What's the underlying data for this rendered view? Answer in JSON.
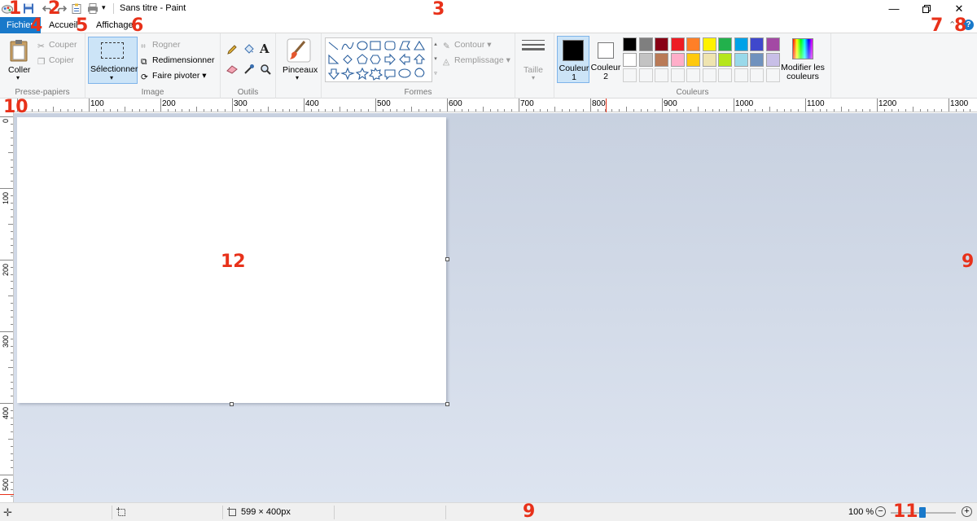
{
  "window": {
    "title": "Sans titre - Paint",
    "controls": [
      "minimize",
      "restore",
      "close"
    ]
  },
  "quick_access": {
    "items": [
      "save-icon",
      "undo-icon",
      "redo-icon",
      "properties-icon",
      "print-icon",
      "customize-dropdown"
    ]
  },
  "tabs": [
    {
      "label": "Fichier"
    },
    {
      "label": "Accueil"
    },
    {
      "label": "Affichage"
    }
  ],
  "ribbon": {
    "clipboard": {
      "label": "Presse-papiers",
      "paste": "Coller",
      "cut": "Couper",
      "copy": "Copier"
    },
    "image": {
      "label": "Image",
      "select": "Sélectionner",
      "crop": "Rogner",
      "resize": "Redimensionner",
      "rotate": "Faire pivoter"
    },
    "tools": {
      "label": "Outils"
    },
    "brushes": {
      "label": "Pinceaux"
    },
    "shapes": {
      "label": "Formes",
      "outline": "Contour",
      "fill": "Remplissage"
    },
    "size": {
      "label": "Taille"
    },
    "colors": {
      "label": "Couleurs",
      "color1": "Couleur 1",
      "color2": "Couleur 2",
      "edit": "Modifier les couleurs",
      "palette_row1": [
        "#000000",
        "#7f7f7f",
        "#880015",
        "#ed1c24",
        "#ff7f27",
        "#fff200",
        "#22b14c",
        "#00a2e8",
        "#3f48cc",
        "#a349a4"
      ],
      "palette_row2": [
        "#ffffff",
        "#c3c3c3",
        "#b97a57",
        "#ffaec9",
        "#ffc90e",
        "#efe4b0",
        "#b5e61d",
        "#99d9ea",
        "#7092be",
        "#c8bfe7"
      ],
      "color1_value": "#000000",
      "color2_value": "#ffffff"
    }
  },
  "rulers": {
    "horizontal": [
      "100",
      "200",
      "300",
      "400",
      "500",
      "600",
      "700",
      "800",
      "900",
      "1000",
      "1100",
      "1200",
      "1300"
    ],
    "vertical": [
      "0",
      "100",
      "200",
      "300",
      "400",
      "500"
    ]
  },
  "status": {
    "image_size": "599 × 400px",
    "zoom": "100 %"
  },
  "annotations": [
    "1",
    "2",
    "3",
    "4",
    "5",
    "6",
    "7",
    "8",
    "9",
    "10",
    "11",
    "12"
  ]
}
